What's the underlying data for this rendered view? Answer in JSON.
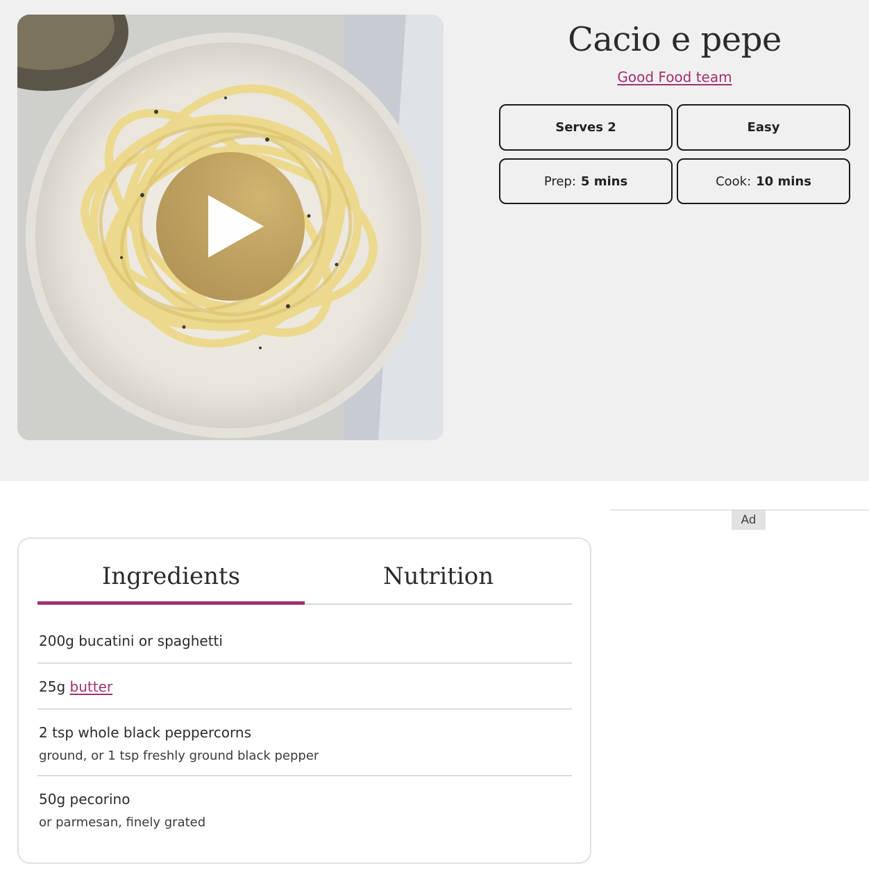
{
  "recipe": {
    "title": "Cacio e pepe",
    "author": "Good Food team",
    "serves": "Serves 2",
    "difficulty": "Easy",
    "prep_label": "Prep:",
    "prep_value": "5 mins",
    "cook_label": "Cook:",
    "cook_value": "10 mins"
  },
  "media": {
    "play_icon": "play-icon"
  },
  "ad": {
    "label": "Ad"
  },
  "tabs": [
    {
      "label": "Ingredients",
      "active": true
    },
    {
      "label": "Nutrition",
      "active": false
    }
  ],
  "ingredients": [
    {
      "main": "200g bucatini or spaghetti"
    },
    {
      "prefix": "25g ",
      "link": "butter"
    },
    {
      "main": "2 tsp whole black peppercorns",
      "note": "ground, or 1 tsp freshly ground black pepper"
    },
    {
      "main": "50g pecorino",
      "note": "or parmesan, finely grated"
    }
  ],
  "colors": {
    "accent": "#a0306e",
    "hero_bg": "#f0f0f0",
    "play_button": "#b99a58"
  }
}
